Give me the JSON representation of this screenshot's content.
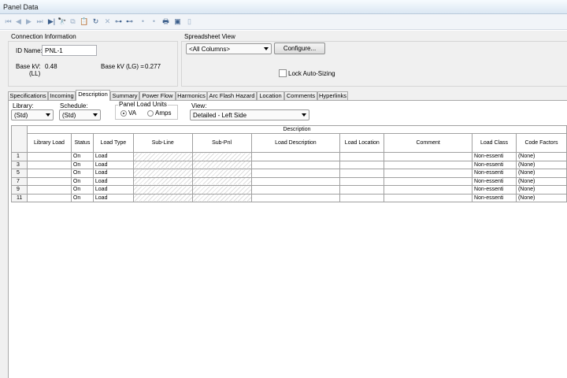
{
  "window": {
    "title": "Panel Data"
  },
  "toolbar": {
    "icons": [
      "first-record-icon",
      "previous-record-icon",
      "next-record-icon",
      "last-record-icon",
      "find-icon",
      "copy-icon",
      "paste-icon",
      "undo-icon",
      "delete-icon",
      "insert-row-icon",
      "delete-row-icon",
      "move-up-icon",
      "move-down-icon",
      "print-icon",
      "report-icon",
      "clipboard-icon"
    ]
  },
  "connection": {
    "group_label": "Connection Information",
    "id_label": "ID Name:",
    "id_value": "PNL-1",
    "basekv_ll_label": "Base kV:",
    "basekv_ll_sub": "(LL)",
    "basekv_ll_value": "0.48",
    "basekv_lg_label": "Base kV (LG) =",
    "basekv_lg_value": "0.277"
  },
  "spreadsheet": {
    "group_label": "Spreadsheet View",
    "columns_value": "<All Columns>",
    "configure_label": "Configure...",
    "lock_label": "Lock Auto-Sizing",
    "lock_checked": false
  },
  "tabs": [
    "Specifications",
    "Incoming",
    "Description",
    "Summary",
    "Power Flow",
    "Harmonics",
    "Arc Flash Hazard",
    "Location",
    "Comments",
    "Hyperlinks"
  ],
  "active_tab": "Description",
  "filters": {
    "library_label": "Library:",
    "library_value": "(Std)",
    "schedule_label": "Schedule:",
    "schedule_value": "(Std)",
    "units_label": "Panel Load Units",
    "unit_va": "VA",
    "unit_amps": "Amps",
    "unit_selected": "VA",
    "view_label": "View:",
    "view_value": "Detailed - Left Side"
  },
  "grid": {
    "group_header": "Description",
    "columns": [
      "Library Load",
      "Status",
      "Load Type",
      "Sub-Line",
      "Sub-Pnl",
      "Load Description",
      "Load Location",
      "Comment",
      "Load Class",
      "Code Factors"
    ],
    "rows": [
      {
        "num": "1",
        "library": "",
        "status": "On",
        "type": "Load",
        "load_class": "Non-essenti",
        "code": "(None)"
      },
      {
        "num": "3",
        "library": "",
        "status": "On",
        "type": "Load",
        "load_class": "Non-essenti",
        "code": "(None)"
      },
      {
        "num": "5",
        "library": "",
        "status": "On",
        "type": "Load",
        "load_class": "Non-essenti",
        "code": "(None)"
      },
      {
        "num": "7",
        "library": "",
        "status": "On",
        "type": "Load",
        "load_class": "Non-essenti",
        "code": "(None)"
      },
      {
        "num": "9",
        "library": "",
        "status": "On",
        "type": "Load",
        "load_class": "Non-essenti",
        "code": "(None)"
      },
      {
        "num": "11",
        "library": "",
        "status": "On",
        "type": "Load",
        "load_class": "Non-essenti",
        "code": "(None)"
      }
    ]
  }
}
